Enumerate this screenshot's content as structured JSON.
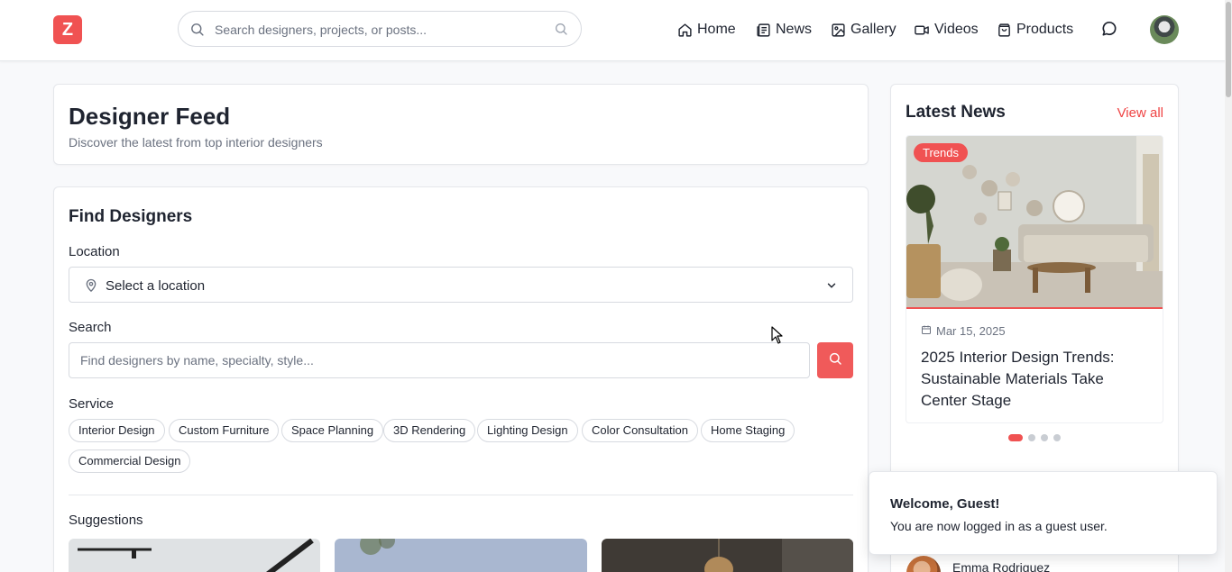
{
  "header": {
    "logo_letter": "Z",
    "search_placeholder": "Search designers, projects, or posts...",
    "nav": [
      {
        "label": "Home",
        "icon": "home-icon"
      },
      {
        "label": "News",
        "icon": "newspaper-icon"
      },
      {
        "label": "Gallery",
        "icon": "image-icon"
      },
      {
        "label": "Videos",
        "icon": "video-icon"
      },
      {
        "label": "Products",
        "icon": "shopping-bag-icon"
      }
    ],
    "chat_icon": "message-circle-icon"
  },
  "feed": {
    "title": "Designer Feed",
    "subtitle": "Discover the latest from top interior designers"
  },
  "find": {
    "title": "Find Designers",
    "location_label": "Location",
    "location_value": "Select a location",
    "search_label": "Search",
    "search_placeholder": "Find designers by name, specialty, style...",
    "service_label": "Service",
    "services": [
      "Interior Design",
      "Custom Furniture",
      "Space Planning",
      "3D Rendering",
      "Lighting Design",
      "Color Consultation",
      "Home Staging",
      "Commercial Design"
    ],
    "suggestions_label": "Suggestions"
  },
  "news": {
    "title": "Latest News",
    "view_all": "View all",
    "item": {
      "badge": "Trends",
      "date": "Mar 15, 2025",
      "headline": "2025 Interior Design Trends: Sustainable Materials Take Center Stage"
    },
    "carousel_total": 4,
    "carousel_active": 1
  },
  "toast": {
    "title": "Welcome, Guest!",
    "message": "You are now logged in as a guest user."
  },
  "peek": {
    "name": "Emma Rodriguez"
  },
  "colors": {
    "accent": "#f05252",
    "background": "#f8f9fb"
  }
}
